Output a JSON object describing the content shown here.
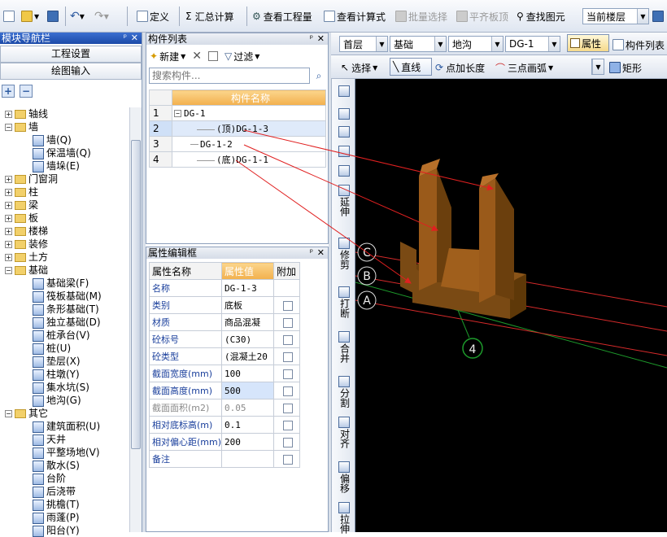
{
  "toolbar": {
    "define_label": "定义",
    "sum_label": "汇总计算",
    "view_qty_label": "查看工程量",
    "view_formula_label": "查看计算式",
    "batch_select_label": "批量选择",
    "align_top_label": "平齐板顶",
    "find_label": "查找图元",
    "floor_combo": "当前楼层"
  },
  "nav": {
    "title": "模块导航栏",
    "btn_project": "工程设置",
    "btn_draw": "绘图输入",
    "tree": [
      {
        "label": "轴线",
        "level": 0,
        "type": "folder",
        "exp": "+"
      },
      {
        "label": "墙",
        "level": 0,
        "type": "folder",
        "exp": "−"
      },
      {
        "label": "墙(Q)",
        "level": 1,
        "type": "leaf"
      },
      {
        "label": "保温墙(Q)",
        "level": 1,
        "type": "leaf"
      },
      {
        "label": "墙垛(E)",
        "level": 1,
        "type": "leaf"
      },
      {
        "label": "门窗洞",
        "level": 0,
        "type": "folder",
        "exp": "+"
      },
      {
        "label": "柱",
        "level": 0,
        "type": "folder",
        "exp": "+"
      },
      {
        "label": "梁",
        "level": 0,
        "type": "folder",
        "exp": "+"
      },
      {
        "label": "板",
        "level": 0,
        "type": "folder",
        "exp": "+"
      },
      {
        "label": "楼梯",
        "level": 0,
        "type": "folder",
        "exp": "+"
      },
      {
        "label": "装修",
        "level": 0,
        "type": "folder",
        "exp": "+"
      },
      {
        "label": "土方",
        "level": 0,
        "type": "folder",
        "exp": "+"
      },
      {
        "label": "基础",
        "level": 0,
        "type": "folder",
        "exp": "−"
      },
      {
        "label": "基础梁(F)",
        "level": 1,
        "type": "leaf"
      },
      {
        "label": "筏板基础(M)",
        "level": 1,
        "type": "leaf"
      },
      {
        "label": "条形基础(T)",
        "level": 1,
        "type": "leaf"
      },
      {
        "label": "独立基础(D)",
        "level": 1,
        "type": "leaf"
      },
      {
        "label": "桩承台(V)",
        "level": 1,
        "type": "leaf"
      },
      {
        "label": "桩(U)",
        "level": 1,
        "type": "leaf"
      },
      {
        "label": "垫层(X)",
        "level": 1,
        "type": "leaf"
      },
      {
        "label": "柱墩(Y)",
        "level": 1,
        "type": "leaf"
      },
      {
        "label": "集水坑(S)",
        "level": 1,
        "type": "leaf"
      },
      {
        "label": "地沟(G)",
        "level": 1,
        "type": "leaf"
      },
      {
        "label": "其它",
        "level": 0,
        "type": "folder",
        "exp": "−"
      },
      {
        "label": "建筑面积(U)",
        "level": 1,
        "type": "leaf"
      },
      {
        "label": "天井",
        "level": 1,
        "type": "leaf"
      },
      {
        "label": "平整场地(V)",
        "level": 1,
        "type": "leaf"
      },
      {
        "label": "散水(S)",
        "level": 1,
        "type": "leaf"
      },
      {
        "label": "台阶",
        "level": 1,
        "type": "leaf"
      },
      {
        "label": "后浇带",
        "level": 1,
        "type": "leaf"
      },
      {
        "label": "挑檐(T)",
        "level": 1,
        "type": "leaf"
      },
      {
        "label": "雨蓬(P)",
        "level": 1,
        "type": "leaf"
      },
      {
        "label": "阳台(Y)",
        "level": 1,
        "type": "leaf"
      }
    ]
  },
  "clist": {
    "title": "构件列表",
    "new_label": "新建",
    "filter_label": "过滤",
    "search_placeholder": "搜索构件...",
    "col_header": "构件名称",
    "rows": [
      {
        "num": "1",
        "name": "DG-1",
        "indent": 0
      },
      {
        "num": "2",
        "name": "(顶)DG-1-3",
        "indent": 2
      },
      {
        "num": "3",
        "name": "DG-1-2",
        "indent": 1
      },
      {
        "num": "4",
        "name": "(底)DG-1-1",
        "indent": 2
      }
    ]
  },
  "prop": {
    "title": "属性编辑框",
    "headers": [
      "属性名称",
      "属性值",
      "附加"
    ],
    "rows": [
      {
        "name": "名称",
        "value": "DG-1-3",
        "chk": false,
        "style": "blue"
      },
      {
        "name": "类别",
        "value": "底板",
        "chk": true,
        "style": "blue"
      },
      {
        "name": "材质",
        "value": "商品混凝",
        "chk": true,
        "style": "blue"
      },
      {
        "name": "砼标号",
        "value": "(C30)",
        "chk": true,
        "style": "blue"
      },
      {
        "name": "砼类型",
        "value": "(混凝土20",
        "chk": true,
        "style": "blue"
      },
      {
        "name": "截面宽度(mm)",
        "value": "100",
        "chk": true,
        "style": "blue"
      },
      {
        "name": "截面高度(mm)",
        "value": "500",
        "chk": true,
        "style": "blue",
        "active": true
      },
      {
        "name": "截面面积(m2)",
        "value": "0.05",
        "chk": true,
        "style": "grey"
      },
      {
        "name": "相对底标高(m)",
        "value": "0.1",
        "chk": true,
        "style": "blue"
      },
      {
        "name": "相对偏心距(mm)",
        "value": "200",
        "chk": true,
        "style": "blue"
      },
      {
        "name": "备注",
        "value": "",
        "chk": true,
        "style": "blue"
      }
    ]
  },
  "bar2": {
    "floor": "首层",
    "category": "基础",
    "type": "地沟",
    "component": "DG-1",
    "prop_btn": "属性",
    "list_btn": "构件列表"
  },
  "bar3": {
    "select_label": "选择",
    "line_label": "直线",
    "point_len_label": "点加长度",
    "arc_label": "三点画弧",
    "rect_label": "矩形"
  },
  "vtools": [
    "延伸",
    "修剪",
    "打断",
    "合并",
    "分割",
    "对齐",
    "偏移",
    "拉伸"
  ],
  "viewport": {
    "axis_labels": [
      "C",
      "B",
      "A",
      "4"
    ]
  }
}
